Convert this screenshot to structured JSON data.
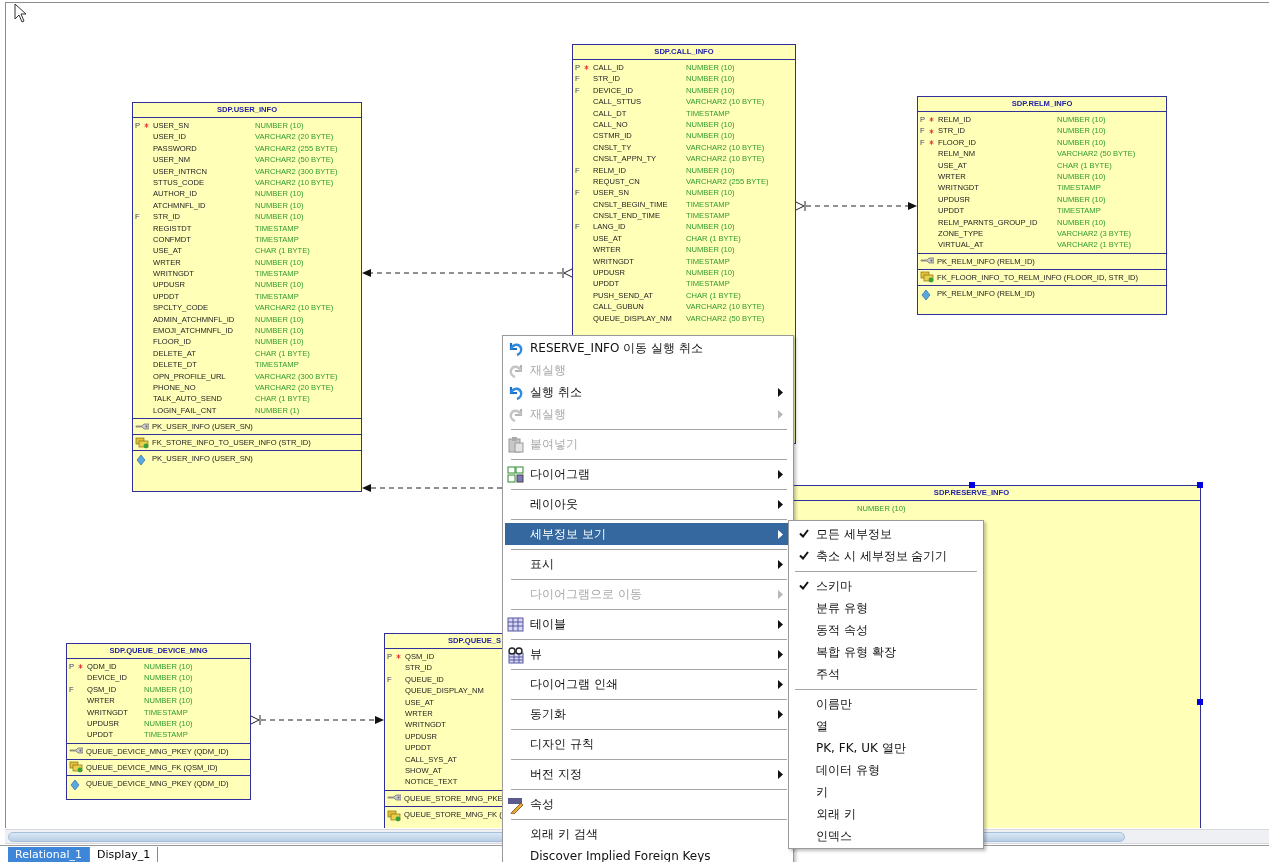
{
  "tables": [
    {
      "title": "SDP.USER_INFO",
      "selected": false,
      "columns": [
        {
          "flag": "P",
          "required": true,
          "name": "USER_SN",
          "type": "NUMBER (10)"
        },
        {
          "required": false,
          "name": "USER_ID",
          "type": "VARCHAR2 (20 BYTE)"
        },
        {
          "required": false,
          "name": "PASSWORD",
          "type": "VARCHAR2 (255 BYTE)"
        },
        {
          "required": false,
          "name": "USER_NM",
          "type": "VARCHAR2 (50 BYTE)"
        },
        {
          "required": false,
          "name": "USER_INTRCN",
          "type": "VARCHAR2 (300 BYTE)"
        },
        {
          "required": false,
          "name": "STTUS_CODE",
          "type": "VARCHAR2 (10 BYTE)"
        },
        {
          "required": false,
          "name": "AUTHOR_ID",
          "type": "NUMBER (10)"
        },
        {
          "required": false,
          "name": "ATCHMNFL_ID",
          "type": "NUMBER (10)"
        },
        {
          "flag": "F",
          "required": false,
          "name": "STR_ID",
          "type": "NUMBER (10)"
        },
        {
          "required": false,
          "name": "REGISTDT",
          "type": "TIMESTAMP"
        },
        {
          "required": false,
          "name": "CONFMDT",
          "type": "TIMESTAMP"
        },
        {
          "required": false,
          "name": "USE_AT",
          "type": "CHAR (1 BYTE)"
        },
        {
          "required": false,
          "name": "WRTER",
          "type": "NUMBER (10)"
        },
        {
          "required": false,
          "name": "WRITNGDT",
          "type": "TIMESTAMP"
        },
        {
          "required": false,
          "name": "UPDUSR",
          "type": "NUMBER (10)"
        },
        {
          "required": false,
          "name": "UPDDT",
          "type": "TIMESTAMP"
        },
        {
          "required": false,
          "name": "SPCLTY_CODE",
          "type": "VARCHAR2 (10 BYTE)"
        },
        {
          "required": false,
          "name": "ADMIN_ATCHMNFL_ID",
          "type": "NUMBER (10)"
        },
        {
          "required": false,
          "name": "EMOJI_ATCHMNFL_ID",
          "type": "NUMBER (10)"
        },
        {
          "required": false,
          "name": "FLOOR_ID",
          "type": "NUMBER (10)"
        },
        {
          "required": false,
          "name": "DELETE_AT",
          "type": "CHAR (1 BYTE)"
        },
        {
          "required": false,
          "name": "DELETE_DT",
          "type": "TIMESTAMP"
        },
        {
          "required": false,
          "name": "OPN_PROFILE_URL",
          "type": "VARCHAR2 (300 BYTE)"
        },
        {
          "required": false,
          "name": "PHONE_NO",
          "type": "VARCHAR2 (20 BYTE)"
        },
        {
          "required": false,
          "name": "TALK_AUTO_SEND",
          "type": "CHAR (1 BYTE)"
        },
        {
          "required": false,
          "name": "LOGIN_FAIL_CNT",
          "type": "NUMBER (1)"
        }
      ],
      "keys": [
        {
          "kind": "pk",
          "label": "PK_USER_INFO (USER_SN)"
        },
        {
          "kind": "fk",
          "label": "FK_STORE_INFO_TO_USER_INFO (STR_ID)"
        },
        {
          "kind": "index",
          "label": "PK_USER_INFO (USER_SN)"
        }
      ]
    },
    {
      "title": "SDP.CALL_INFO",
      "selected": false,
      "columns": [
        {
          "flag": "P",
          "required": true,
          "name": "CALL_ID",
          "type": "NUMBER (10)"
        },
        {
          "flag": "F",
          "required": false,
          "name": "STR_ID",
          "type": "NUMBER (10)"
        },
        {
          "flag": "F",
          "required": false,
          "name": "DEVICE_ID",
          "type": "NUMBER (10)"
        },
        {
          "required": false,
          "name": "CALL_STTUS",
          "type": "VARCHAR2 (10 BYTE)"
        },
        {
          "required": false,
          "name": "CALL_DT",
          "type": "TIMESTAMP"
        },
        {
          "required": false,
          "name": "CALL_NO",
          "type": "NUMBER (10)"
        },
        {
          "required": false,
          "name": "CSTMR_ID",
          "type": "NUMBER (10)"
        },
        {
          "required": false,
          "name": "CNSLT_TY",
          "type": "VARCHAR2 (10 BYTE)"
        },
        {
          "required": false,
          "name": "CNSLT_APPN_TY",
          "type": "VARCHAR2 (10 BYTE)"
        },
        {
          "flag": "F",
          "required": false,
          "name": "RELM_ID",
          "type": "NUMBER (10)"
        },
        {
          "required": false,
          "name": "REQUST_CN",
          "type": "VARCHAR2 (255 BYTE)"
        },
        {
          "flag": "F",
          "required": false,
          "name": "USER_SN",
          "type": "NUMBER (10)"
        },
        {
          "required": false,
          "name": "CNSLT_BEGIN_TIME",
          "type": "TIMESTAMP"
        },
        {
          "required": false,
          "name": "CNSLT_END_TIME",
          "type": "TIMESTAMP"
        },
        {
          "flag": "F",
          "required": false,
          "name": "LANG_ID",
          "type": "NUMBER (10)"
        },
        {
          "required": false,
          "name": "USE_AT",
          "type": "CHAR (1 BYTE)"
        },
        {
          "required": false,
          "name": "WRTER",
          "type": "NUMBER (10)"
        },
        {
          "required": false,
          "name": "WRITNGDT",
          "type": "TIMESTAMP"
        },
        {
          "required": false,
          "name": "UPDUSR",
          "type": "NUMBER (10)"
        },
        {
          "required": false,
          "name": "UPDDT",
          "type": "TIMESTAMP"
        },
        {
          "required": false,
          "name": "PUSH_SEND_AT",
          "type": "CHAR (1 BYTE)"
        },
        {
          "required": false,
          "name": "CALL_GUBUN",
          "type": "VARCHAR2 (10 BYTE)"
        },
        {
          "required": false,
          "name": "QUEUE_DISPLAY_NM",
          "type": "VARCHAR2 (50 BYTE)"
        }
      ]
    },
    {
      "title": "SDP.RELM_INFO",
      "selected": false,
      "columns": [
        {
          "flag": "P",
          "required": true,
          "name": "RELM_ID",
          "type": "NUMBER (10)"
        },
        {
          "flag": "F",
          "required": true,
          "name": "STR_ID",
          "type": "NUMBER (10)"
        },
        {
          "flag": "F",
          "required": true,
          "name": "FLOOR_ID",
          "type": "NUMBER (10)"
        },
        {
          "required": false,
          "name": "RELM_NM",
          "type": "VARCHAR2 (50 BYTE)"
        },
        {
          "required": false,
          "name": "USE_AT",
          "type": "CHAR (1 BYTE)"
        },
        {
          "required": false,
          "name": "WRTER",
          "type": "NUMBER (10)"
        },
        {
          "required": false,
          "name": "WRITNGDT",
          "type": "TIMESTAMP"
        },
        {
          "required": false,
          "name": "UPDUSR",
          "type": "NUMBER (10)"
        },
        {
          "required": false,
          "name": "UPDDT",
          "type": "TIMESTAMP"
        },
        {
          "required": false,
          "name": "RELM_PARNTS_GROUP_ID",
          "type": "NUMBER (10)"
        },
        {
          "required": false,
          "name": "ZONE_TYPE",
          "type": "VARCHAR2 (3 BYTE)"
        },
        {
          "required": false,
          "name": "VIRTUAL_AT",
          "type": "VARCHAR2 (1 BYTE)"
        }
      ],
      "keys": [
        {
          "kind": "pk",
          "label": "PK_RELM_INFO (RELM_ID)"
        },
        {
          "kind": "fk",
          "label": "FK_FLOOR_INFO_TO_RELM_INFO (FLOOR_ID, STR_ID)"
        },
        {
          "kind": "index",
          "label": "PK_RELM_INFO (RELM_ID)"
        }
      ]
    },
    {
      "title": "SDP.RESERVE_INFO",
      "selected": true,
      "columns": [
        {
          "type": "NUMBER (10)"
        }
      ]
    },
    {
      "title": "SDP.QUEUE_DEVICE_MNG",
      "selected": false,
      "columns": [
        {
          "flag": "P",
          "required": true,
          "name": "QDM_ID",
          "type": "NUMBER (10)"
        },
        {
          "required": false,
          "name": "DEVICE_ID",
          "type": "NUMBER (10)"
        },
        {
          "flag": "F",
          "required": false,
          "name": "QSM_ID",
          "type": "NUMBER (10)"
        },
        {
          "required": false,
          "name": "WRTER",
          "type": "NUMBER (10)"
        },
        {
          "required": false,
          "name": "WRITNGDT",
          "type": "TIMESTAMP"
        },
        {
          "required": false,
          "name": "UPDUSR",
          "type": "NUMBER (10)"
        },
        {
          "required": false,
          "name": "UPDDT",
          "type": "TIMESTAMP"
        }
      ],
      "keys": [
        {
          "kind": "pk",
          "label": "QUEUE_DEVICE_MNG_PKEY (QDM_ID)"
        },
        {
          "kind": "fk",
          "label": "QUEUE_DEVICE_MNG_FK (QSM_ID)"
        },
        {
          "kind": "index",
          "label": "QUEUE_DEVICE_MNG_PKEY (QDM_ID)"
        }
      ]
    },
    {
      "title": "SDP.QUEUE_S",
      "selected": false,
      "columns": [
        {
          "flag": "P",
          "required": true,
          "name": "QSM_ID"
        },
        {
          "required": false,
          "name": "STR_ID"
        },
        {
          "flag": "F",
          "required": false,
          "name": "QUEUE_ID"
        },
        {
          "required": false,
          "name": "QUEUE_DISPLAY_NM"
        },
        {
          "required": false,
          "name": "USE_AT"
        },
        {
          "required": false,
          "name": "WRTER"
        },
        {
          "required": false,
          "name": "WRITNGDT"
        },
        {
          "required": false,
          "name": "UPDUSR"
        },
        {
          "required": false,
          "name": "UPDDT"
        },
        {
          "required": false,
          "name": "CALL_SYS_AT"
        },
        {
          "required": false,
          "name": "SHOW_AT"
        },
        {
          "required": false,
          "name": "NOTICE_TEXT"
        }
      ],
      "keys": [
        {
          "kind": "pk",
          "label": "QUEUE_STORE_MNG_PKE"
        },
        {
          "kind": "fk",
          "label": "QUEUE_STORE_MNG_FK ("
        }
      ]
    }
  ],
  "context_menu": {
    "items": [
      {
        "kind": "item",
        "label": "RESERVE_INFO 이동 실행 취소",
        "disabled": false,
        "submenu": false,
        "selected": false
      },
      {
        "kind": "item",
        "label": "재실행",
        "disabled": true,
        "submenu": false,
        "selected": false
      },
      {
        "kind": "item",
        "label": "실행 취소",
        "disabled": false,
        "submenu": true,
        "selected": false
      },
      {
        "kind": "item",
        "label": "재실행",
        "disabled": true,
        "submenu": true,
        "selected": false
      },
      {
        "kind": "separator"
      },
      {
        "kind": "item",
        "label": "붙여넣기",
        "disabled": true,
        "submenu": false,
        "selected": false
      },
      {
        "kind": "separator"
      },
      {
        "kind": "item",
        "label": "다이어그램",
        "disabled": false,
        "submenu": true,
        "selected": false
      },
      {
        "kind": "separator"
      },
      {
        "kind": "item",
        "label": "레이아웃",
        "disabled": false,
        "submenu": true,
        "selected": false
      },
      {
        "kind": "separator"
      },
      {
        "kind": "item",
        "label": "세부정보 보기",
        "disabled": false,
        "submenu": true,
        "selected": true
      },
      {
        "kind": "separator"
      },
      {
        "kind": "item",
        "label": "표시",
        "disabled": false,
        "submenu": true,
        "selected": false
      },
      {
        "kind": "separator"
      },
      {
        "kind": "item",
        "label": "다이어그램으로 이동",
        "disabled": true,
        "submenu": true,
        "selected": false
      },
      {
        "kind": "separator"
      },
      {
        "kind": "item",
        "label": "테이블",
        "disabled": false,
        "submenu": true,
        "selected": false
      },
      {
        "kind": "separator"
      },
      {
        "kind": "item",
        "label": "뷰",
        "disabled": false,
        "submenu": true,
        "selected": false
      },
      {
        "kind": "separator"
      },
      {
        "kind": "item",
        "label": "다이어그램 인쇄",
        "disabled": false,
        "submenu": true,
        "selected": false
      },
      {
        "kind": "separator"
      },
      {
        "kind": "item",
        "label": "동기화",
        "disabled": false,
        "submenu": true,
        "selected": false
      },
      {
        "kind": "separator"
      },
      {
        "kind": "item",
        "label": "디자인 규칙",
        "disabled": false,
        "submenu": false,
        "selected": false
      },
      {
        "kind": "separator"
      },
      {
        "kind": "item",
        "label": "버전 지정",
        "disabled": false,
        "submenu": true,
        "selected": false
      },
      {
        "kind": "separator"
      },
      {
        "kind": "item",
        "label": "속성",
        "disabled": false,
        "submenu": false,
        "selected": false
      },
      {
        "kind": "separator"
      },
      {
        "kind": "item",
        "label": "외래 키 검색",
        "disabled": false,
        "submenu": false,
        "selected": false
      },
      {
        "kind": "item",
        "label": "Discover Implied Foreign Keys",
        "disabled": false,
        "submenu": false,
        "selected": false
      }
    ]
  },
  "submenu": {
    "items": [
      {
        "kind": "item",
        "label": "모든 세부정보",
        "checked": true
      },
      {
        "kind": "item",
        "label": "축소 시 세부정보 숨기기",
        "checked": true
      },
      {
        "kind": "separator"
      },
      {
        "kind": "item",
        "label": "스키마",
        "checked": true
      },
      {
        "kind": "item",
        "label": "분류 유형",
        "checked": false
      },
      {
        "kind": "item",
        "label": "동적 속성",
        "checked": false
      },
      {
        "kind": "item",
        "label": "복합 유형 확장",
        "checked": false
      },
      {
        "kind": "item",
        "label": "주석",
        "checked": false
      },
      {
        "kind": "separator"
      },
      {
        "kind": "item",
        "label": "이름만",
        "checked": false
      },
      {
        "kind": "item",
        "label": "열",
        "checked": false
      },
      {
        "kind": "item",
        "label": "PK, FK, UK 열만",
        "checked": false
      },
      {
        "kind": "item",
        "label": "데이터 유형",
        "checked": false
      },
      {
        "kind": "item",
        "label": "키",
        "checked": false
      },
      {
        "kind": "item",
        "label": "외래 키",
        "checked": false
      },
      {
        "kind": "item",
        "label": "인덱스",
        "checked": false
      }
    ]
  },
  "tabs": [
    {
      "label": "Relational_1",
      "selected": true
    },
    {
      "label": "Display_1",
      "selected": false
    }
  ]
}
